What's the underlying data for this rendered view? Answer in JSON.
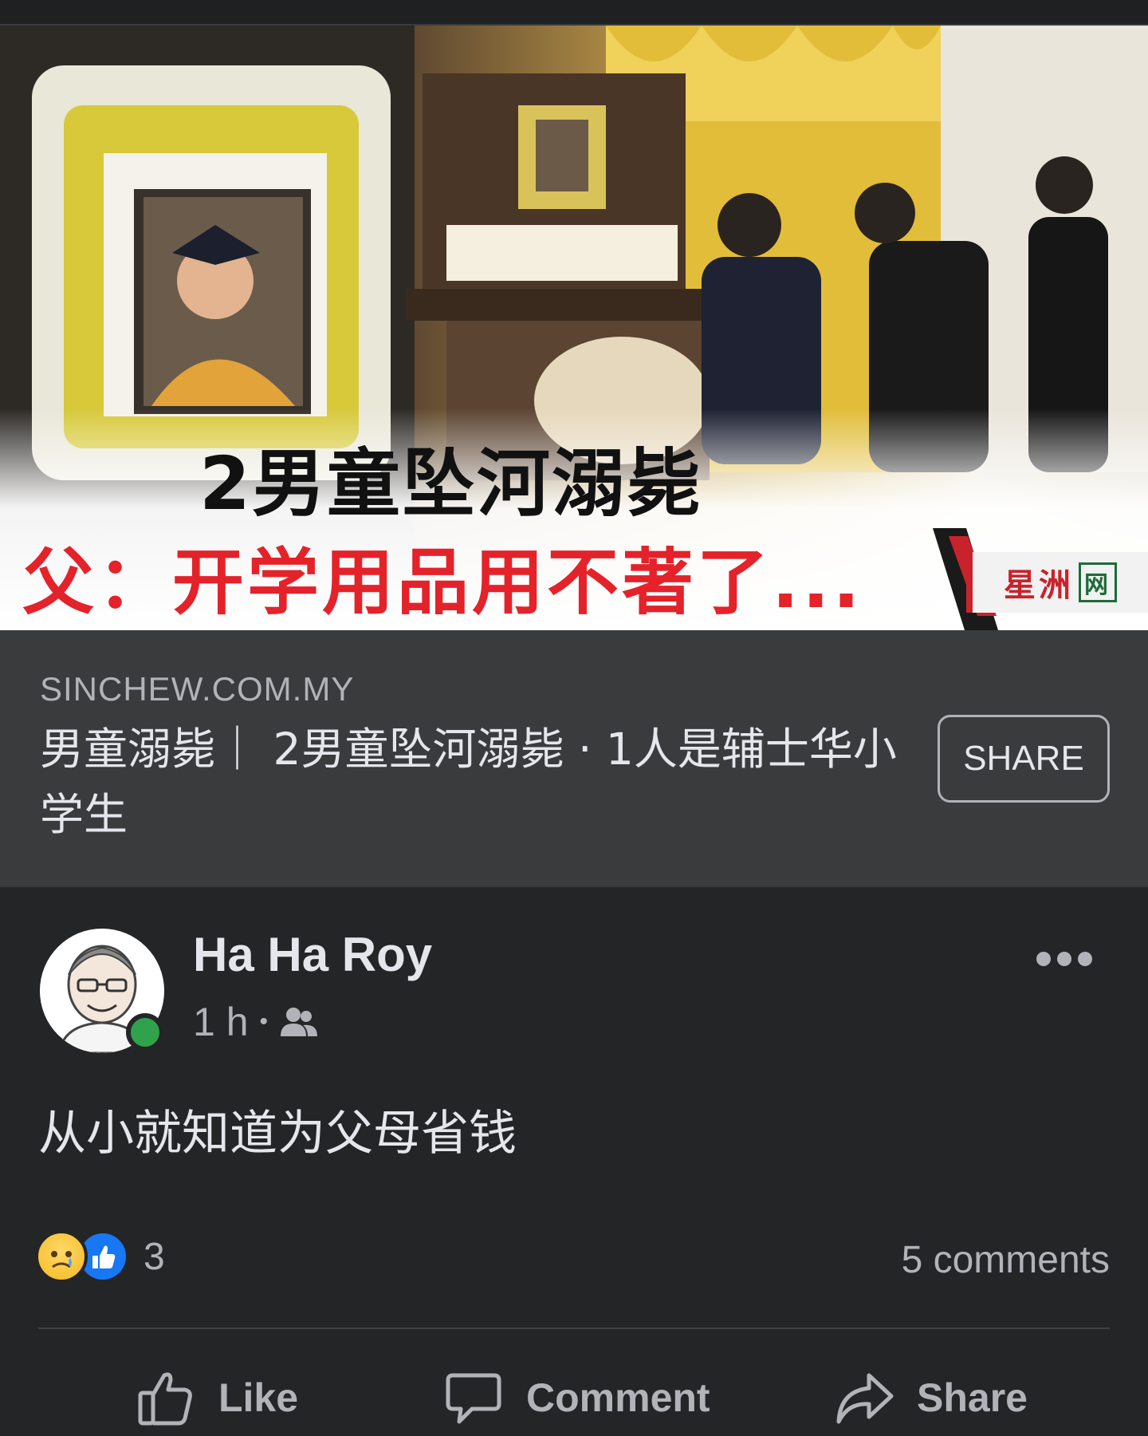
{
  "image": {
    "headline_line1": "2男童坠河溺毙",
    "headline_line2": "父：开学用品用不著了...",
    "brand_logo_text": "星洲",
    "brand_logo_box": "网"
  },
  "link_preview": {
    "domain": "SINCHEW.COM.MY",
    "title": "男童溺毙｜ 2男童坠河溺毙 · 1人是辅士华小学生",
    "share_label": "SHARE"
  },
  "post": {
    "author": "Ha Ha Roy",
    "time": "1 h",
    "audience_icon": "friends-icon",
    "text": "从小就知道为父母省钱",
    "reaction_count": "3",
    "comments_label": "5 comments",
    "online": true
  },
  "actions": {
    "like": "Like",
    "comment": "Comment",
    "share": "Share"
  },
  "colors": {
    "background": "#242526",
    "preview_bg": "#3a3b3c",
    "text_primary": "#e4e6eb",
    "text_secondary": "#b0b3b8",
    "headline_red": "#e4222a",
    "online_green": "#31a24c",
    "like_blue": "#1877f2"
  }
}
